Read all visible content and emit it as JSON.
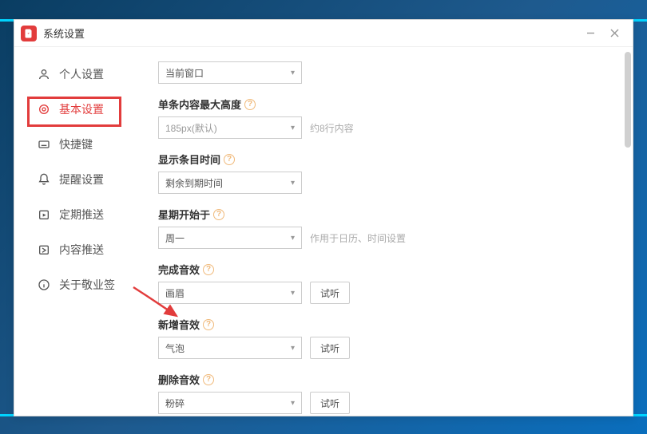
{
  "window": {
    "title": "系统设置"
  },
  "sidebar": {
    "items": [
      {
        "label": "个人设置"
      },
      {
        "label": "基本设置"
      },
      {
        "label": "快捷键"
      },
      {
        "label": "提醒设置"
      },
      {
        "label": "定期推送"
      },
      {
        "label": "内容推送"
      },
      {
        "label": "关于敬业签"
      }
    ]
  },
  "form": {
    "window_target": {
      "value": "当前窗口"
    },
    "max_height": {
      "label": "单条内容最大高度",
      "value": "185px(默认)",
      "hint": "约8行内容"
    },
    "display_time": {
      "label": "显示条目时间",
      "value": "剩余到期时间"
    },
    "week_start": {
      "label": "星期开始于",
      "value": "周一",
      "hint": "作用于日历、时间设置"
    },
    "sound_complete": {
      "label": "完成音效",
      "value": "画眉",
      "test": "试听"
    },
    "sound_add": {
      "label": "新增音效",
      "value": "气泡",
      "test": "试听"
    },
    "sound_delete": {
      "label": "删除音效",
      "value": "粉碎",
      "test": "试听"
    }
  }
}
